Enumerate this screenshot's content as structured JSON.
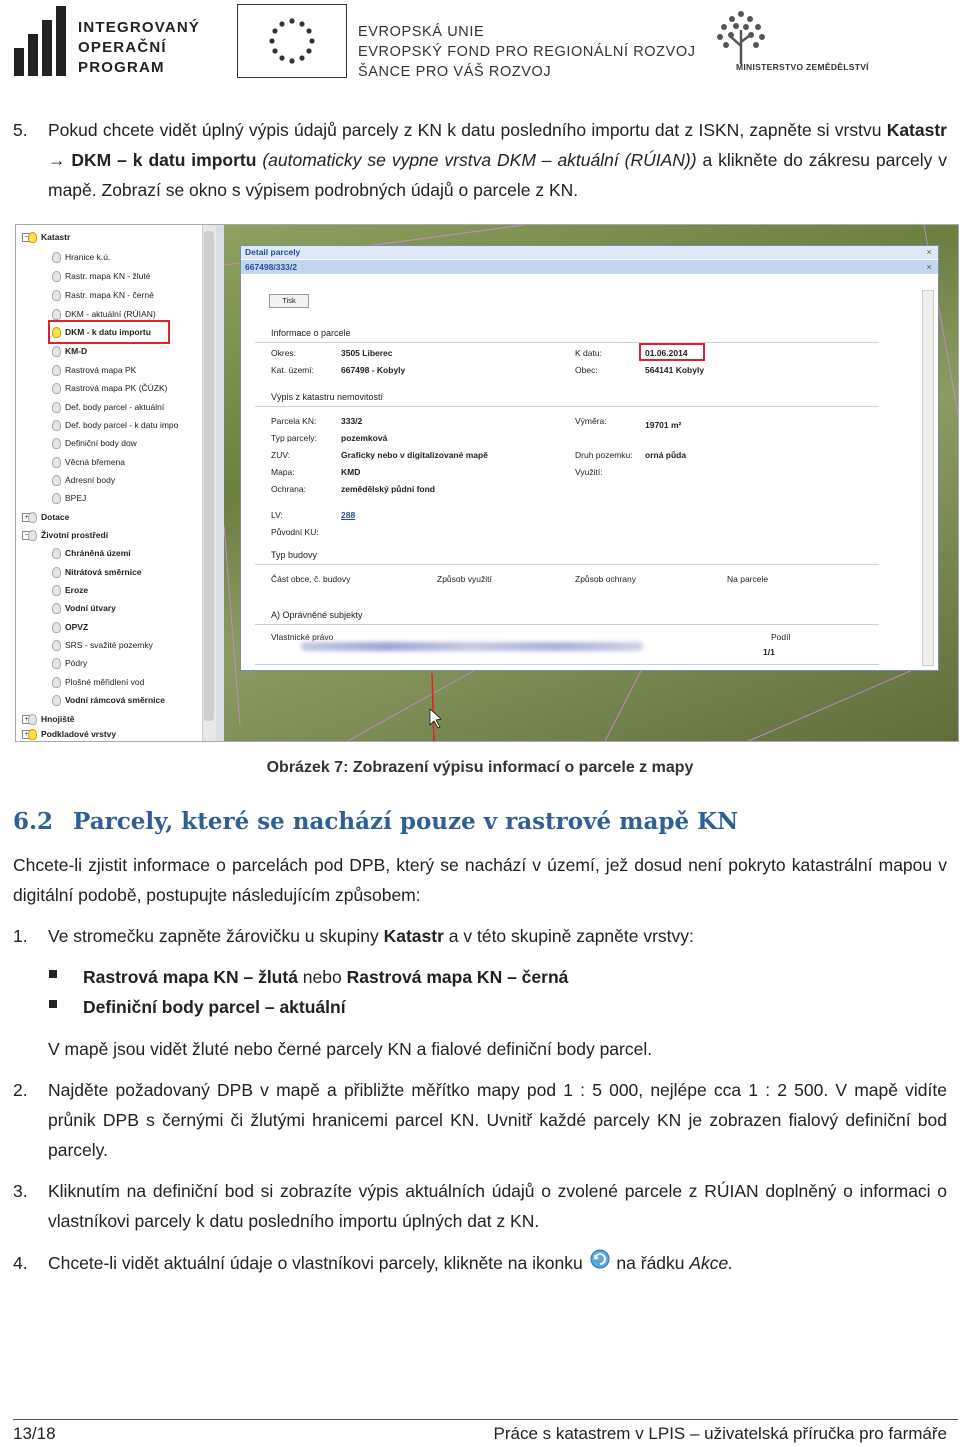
{
  "header": {
    "iop_logo_lines": [
      "INTEGROVANÝ",
      "OPERAČNÍ",
      "PROGRAM"
    ],
    "eu_lines": [
      "EVROPSKÁ UNIE",
      "EVROPSKÝ FOND PRO REGIONÁLNÍ ROZVOJ",
      "ŠANCE PRO VÁŠ ROZVOJ"
    ],
    "ministry": "MINISTERSTVO ZEMĚDĚLSTVÍ"
  },
  "step5": {
    "num": "5.",
    "t1": "Pokud chcete vidět úplný výpis údajů parcely z KN k datu posledního importu dat z ISKN, zapněte si vrstvu ",
    "b1": "Katastr → DKM – k datu importu",
    "i1": " (automaticky se vypne vrstva DKM – aktuální (RÚIAN))",
    "t2": " a klikněte do zákresu parcely v mapě. Zobrazí se okno s výpisem podrobných údajů o parcele z KN."
  },
  "figure": {
    "caption": "Obrázek 7: Zobrazení výpisu informací o parcele z mapy",
    "tree": [
      "Katastr",
      "Hranice k.ú.",
      "Rastr. mapa KN - žluté",
      "Rastr. mapa KN - černé",
      "DKM - aktuální (RÚIAN)",
      "DKM - k datu importu",
      "KM-D",
      "Rastrová mapa PK",
      "Rastrová mapa PK (ČÚZK)",
      "Def. body parcel - aktuální",
      "Def. body parcel - k datu impo",
      "Definiční body dow",
      "Věcná břemena",
      "Adresní body",
      "BPEJ",
      "Dotace",
      "Životní prostředí",
      "Chráněná území",
      "Nitrátová směrnice",
      "Eroze",
      "Vodní útvary",
      "OPVZ",
      "SRS - svažité pozemky",
      "Pódry",
      "Plošné měřidlení vod",
      "Vodní rámcová směrnice",
      "Hnojiště",
      "Podkladové vrstvy"
    ],
    "dialog": {
      "title": "Detail parcely",
      "parcel": "667498/333/2",
      "tab": "Tisk",
      "info_header": "Informace o parcele",
      "okres_l": "Okres:",
      "okres_v": "3505 Liberec",
      "kdatu_l": "K datu:",
      "kdatu_v": "01.06.2014",
      "katuz_l": "Kat. území:",
      "katuz_v": "667498 - Kobyly",
      "obec_l": "Obec:",
      "obec_v": "564141 Kobyly",
      "vypis": "Výpis z katastru nemovitostí",
      "parc_l": "Parcela KN:",
      "parc_v": "333/2",
      "vym_l": "Výměra:",
      "vym_v": "19701 m²",
      "typ_l": "Typ parcely:",
      "typ_v": "pozemková",
      "zuv_l": "ZUV:",
      "zuv_v": "Graficky nebo v digitalizované mapě",
      "druh_l": "Druh pozemku:",
      "druh_v": "orná půda",
      "mapa_l": "Mapa:",
      "mapa_v": "KMD",
      "vyuz_l": "Využití:",
      "ochr_l": "Ochrana:",
      "ochr_v": "zemědělský půdní fond",
      "lv_l": "LV:",
      "lv_v": "288",
      "pku_l": "Původní KU:",
      "budovy": "Typ budovy",
      "cast_l": "Část obce, č. budovy",
      "zpv_l": "Způsob využití",
      "zpo_l": "Způsob ochrany",
      "napar_l": "Na parcele",
      "subjekty": "A) Oprávněné subjekty",
      "vlast_l": "Vlastnické právo",
      "podil_l": "Podíl",
      "podil_v": "1/1"
    }
  },
  "section": {
    "number": "6.2",
    "title": "Parcely, které se nachází pouze v rastrové mapě KN",
    "intro": "Chcete-li zjistit informace o parcelách pod DPB, který se nachází v území, jež dosud není pokryto katastrální mapou v digitální podobě, postupujte následujícím způsobem:"
  },
  "steps": {
    "s1_num": "1.",
    "s1_t1": "Ve stromečku zapněte žárovičku u skupiny ",
    "s1_b1": "Katastr",
    "s1_t2": " a v této skupině zapněte vrstvy:",
    "bullet1_b1": "Rastrová mapa KN – žlutá",
    "bullet1_t": " nebo ",
    "bullet1_b2": "Rastrová mapa KN – černá",
    "bullet2_b": "Definiční body parcel – aktuální",
    "s1_after": "V mapě jsou vidět žluté nebo černé parcely KN a fialové definiční body parcel.",
    "s2_num": "2.",
    "s2": "Najděte požadovaný DPB v mapě a přibližte měřítko mapy pod 1 : 5 000, nejlépe cca 1 : 2 500. V mapě vidíte průnik DPB s černými či žlutými hranicemi parcel KN. Uvnitř každé parcely KN je zobrazen fialový definiční bod parcely.",
    "s3_num": "3.",
    "s3": "Kliknutím na definiční bod si zobrazíte výpis aktuálních údajů o zvolené parcele z RÚIAN doplněný o informaci o vlastníkovi parcely k datu posledního importu úplných dat z KN.",
    "s4_num": "4.",
    "s4_t1": "Chcete-li vidět aktuální údaje o vlastníkovi parcely, klikněte na ikonku ",
    "s4_t2": " na řádku ",
    "s4_i": "Akce."
  },
  "footer": {
    "page": "13/18",
    "title": "Práce s katastrem v LPIS – uživatelská příručka pro farmáře"
  }
}
